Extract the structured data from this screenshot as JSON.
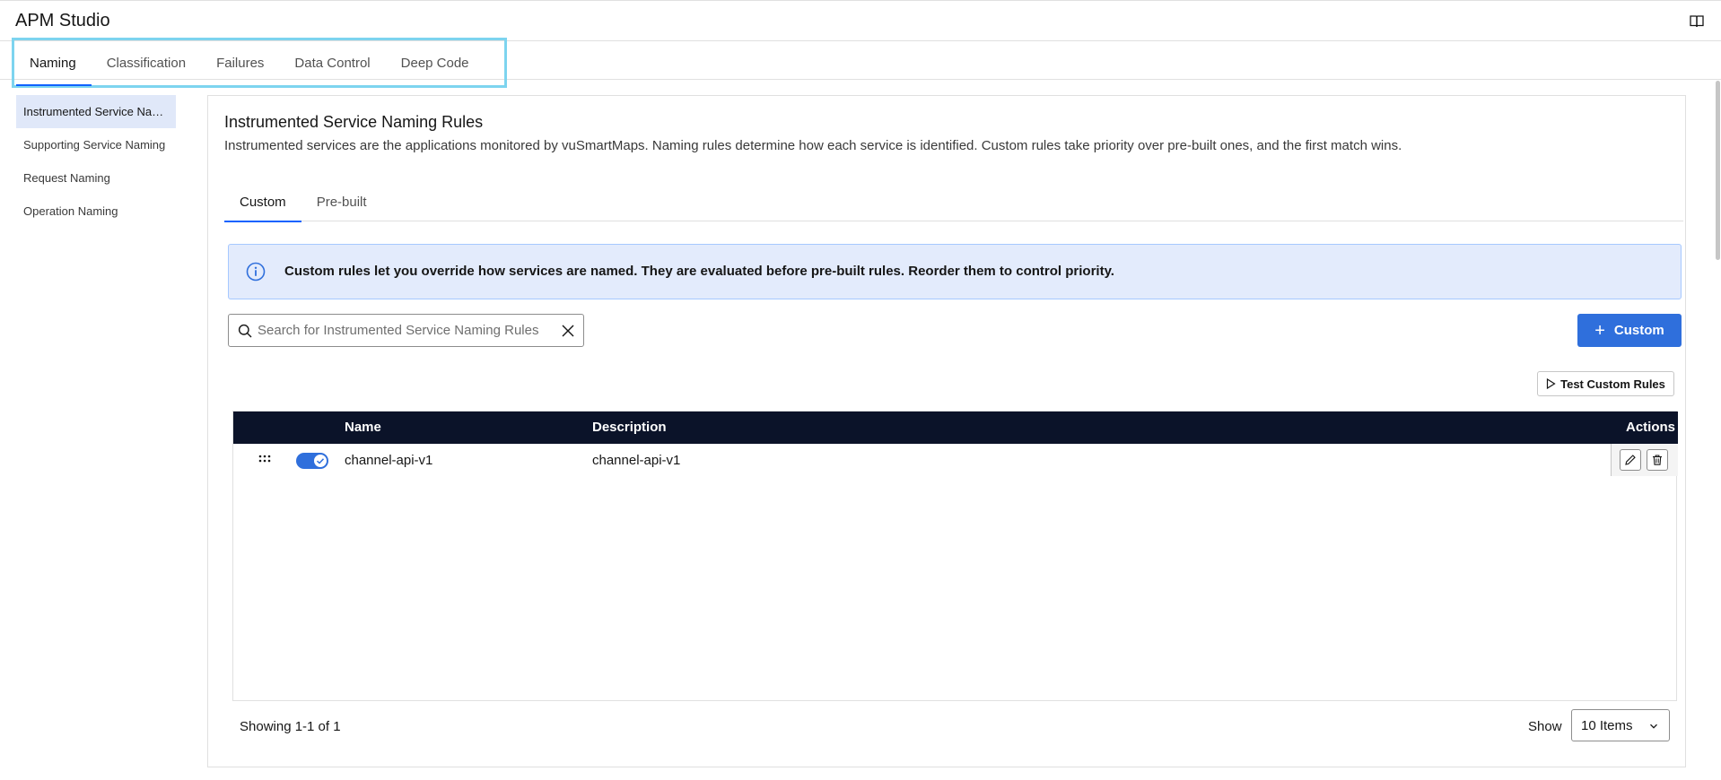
{
  "app": {
    "title": "APM Studio"
  },
  "main_tabs": [
    {
      "label": "Naming",
      "active": true
    },
    {
      "label": "Classification",
      "active": false
    },
    {
      "label": "Failures",
      "active": false
    },
    {
      "label": "Data Control",
      "active": false
    },
    {
      "label": "Deep Code",
      "active": false
    }
  ],
  "sidebar": {
    "items": [
      {
        "label": "Instrumented Service Naming",
        "active": true
      },
      {
        "label": "Supporting Service Naming",
        "active": false
      },
      {
        "label": "Request Naming",
        "active": false
      },
      {
        "label": "Operation Naming",
        "active": false
      }
    ]
  },
  "panel": {
    "title": "Instrumented Service Naming Rules",
    "description": "Instrumented services are the applications monitored by vuSmartMaps. Naming rules determine how each service is identified. Custom rules take priority over pre-built ones, and the first match wins."
  },
  "sub_tabs": [
    {
      "label": "Custom",
      "active": true
    },
    {
      "label": "Pre-built",
      "active": false
    }
  ],
  "info": {
    "text": "Custom rules let you override how services are named. They are evaluated before pre-built rules. Reorder them to control priority."
  },
  "search": {
    "placeholder": "Search for Instrumented Service Naming Rules",
    "value": ""
  },
  "buttons": {
    "custom_label": "Custom",
    "test_label": "Test Custom Rules"
  },
  "table": {
    "columns": {
      "name": "Name",
      "description": "Description",
      "actions": "Actions"
    },
    "rows": [
      {
        "name": "channel-api-v1",
        "description": "channel-api-v1",
        "enabled": true
      }
    ]
  },
  "footer": {
    "count_text": "Showing 1-1 of 1",
    "show_label": "Show",
    "page_size": "10 Items"
  },
  "colors": {
    "accent": "#2f6fdc",
    "table_header": "#0b1329",
    "info_bg": "#e3ebfc",
    "highlight_border": "#7dd4ef"
  },
  "icons": {
    "book": "book-icon",
    "info": "info-icon",
    "search": "search-icon",
    "clear": "close-icon",
    "plus": "plus-icon",
    "play": "play-icon",
    "drag": "drag-handle-icon",
    "edit": "pencil-icon",
    "delete": "trash-icon",
    "chevron": "chevron-down-icon"
  }
}
